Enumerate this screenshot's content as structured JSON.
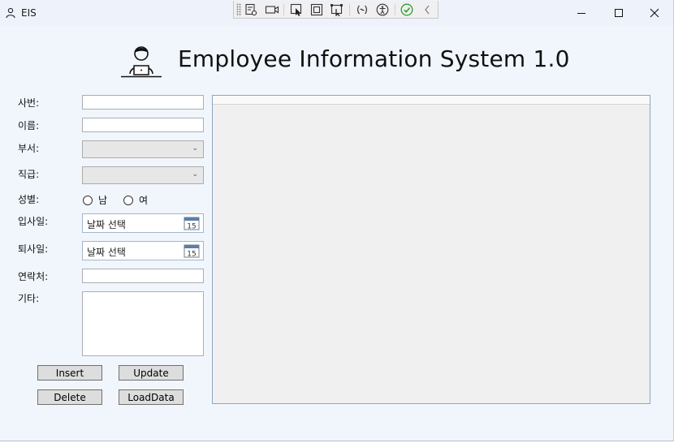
{
  "window": {
    "title": "EIS"
  },
  "header": {
    "title": "Employee Information System 1.0"
  },
  "form": {
    "emp_no_label": "사번:",
    "name_label": "이름:",
    "dept_label": "부서:",
    "rank_label": "직급:",
    "gender_label": "성별:",
    "gender_options": [
      "남",
      "여"
    ],
    "hire_date_label": "입사일:",
    "hire_date_value": "날짜 선택",
    "leave_date_label": "퇴사일:",
    "leave_date_value": "날짜 선택",
    "contact_label": "연락처:",
    "etc_label": "기타:",
    "emp_no_value": "",
    "name_value": "",
    "contact_value": "",
    "etc_value": ""
  },
  "buttons": {
    "insert": "Insert",
    "update": "Update",
    "delete": "Delete",
    "loaddata": "LoadData"
  },
  "icons": {
    "app": "person-icon",
    "header": "employee-laptop-icon",
    "calendar": "calendar-icon",
    "toolbar": [
      "select-element-icon",
      "video-icon",
      "pointer-icon",
      "select-box-icon",
      "layout-adorner-icon",
      "binding-icon",
      "accessibility-icon",
      "check-icon",
      "collapse-chevron-icon"
    ]
  },
  "colors": {
    "window_bg": "#f1f6fd",
    "grid_border": "#8ea6be",
    "check_green": "#2e9e2e"
  }
}
